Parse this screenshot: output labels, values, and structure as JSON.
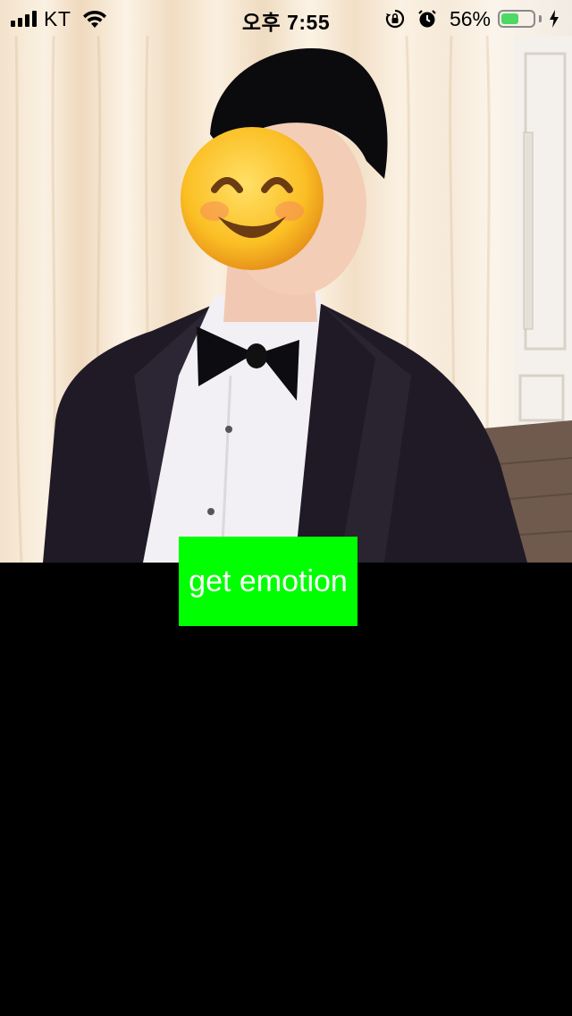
{
  "status_bar": {
    "carrier": "KT",
    "time": "오후 7:55",
    "battery_percent": "56%",
    "battery_level": 0.56,
    "icons": [
      "signal-icon",
      "wifi-icon",
      "orientation-lock-icon",
      "alarm-icon",
      "battery-icon",
      "charging-bolt-icon"
    ]
  },
  "photo": {
    "overlay_emoji": "smiling-face-emoji"
  },
  "actions": {
    "get_emotion_label": "get emotion"
  },
  "colors": {
    "button_background": "#00ff00",
    "button_text": "#ffffff",
    "background": "#000000",
    "battery_fill": "#4cd964"
  }
}
